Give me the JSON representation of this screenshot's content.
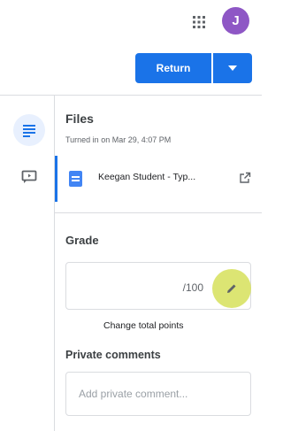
{
  "header": {
    "apps_icon": "apps-grid-icon",
    "avatar_initial": "J",
    "avatar_color": "#8e57c5"
  },
  "toolbar": {
    "return_label": "Return",
    "dropdown_icon": "caret-down-icon",
    "accent_color": "#1a73e8"
  },
  "rail": {
    "items": [
      {
        "icon": "files-icon",
        "active": true
      },
      {
        "icon": "comment-icon",
        "active": false
      }
    ]
  },
  "files": {
    "title": "Files",
    "status": "Turned in on Mar 29, 4:07 PM",
    "items": [
      {
        "name": "Keegan Student - Typ...",
        "icon": "google-docs-icon",
        "action_icon": "open-in-new-icon"
      }
    ]
  },
  "grade": {
    "title": "Grade",
    "value": "",
    "total": "/100",
    "edit_icon": "edit-pencil-icon",
    "tooltip": "Change total points",
    "highlight_color": "#d6e05a"
  },
  "private_comments": {
    "title": "Private comments",
    "placeholder": "Add private comment...",
    "value": ""
  }
}
